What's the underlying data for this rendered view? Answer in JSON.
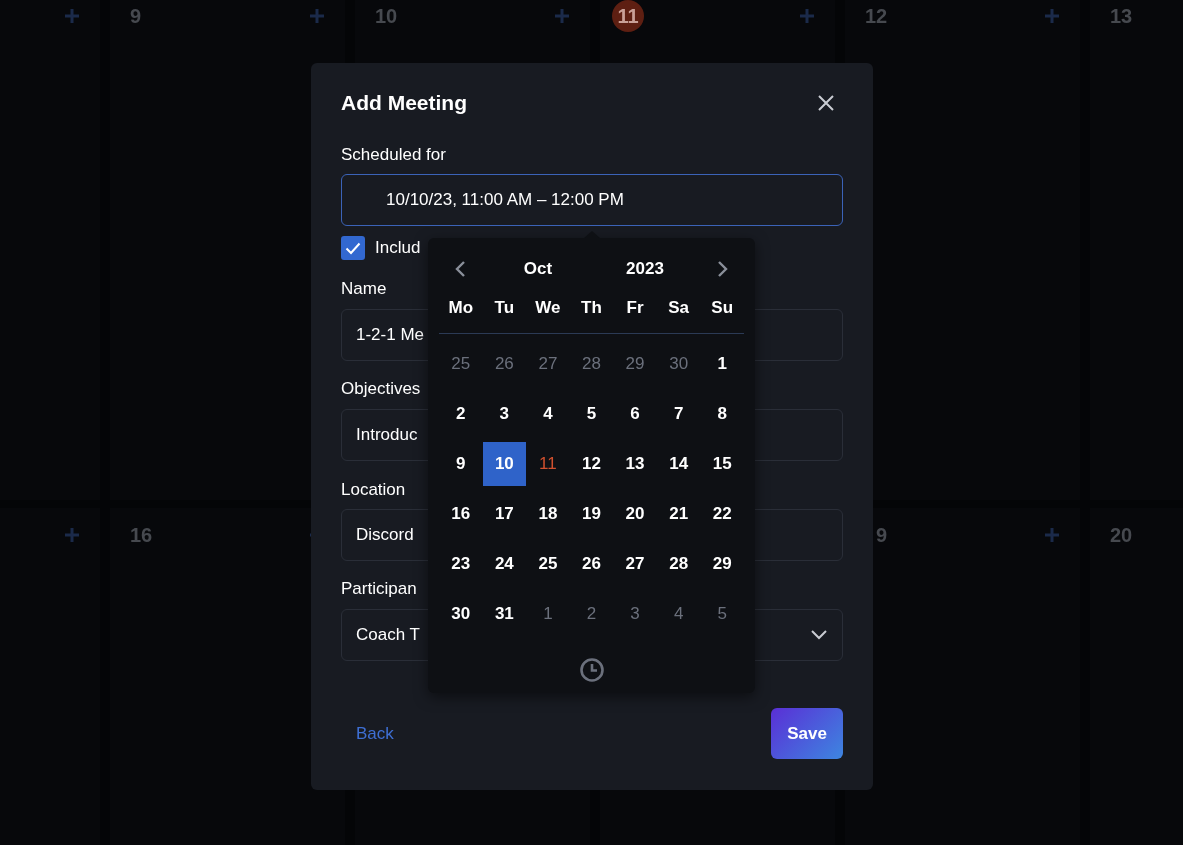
{
  "calendar": {
    "rows": [
      {
        "cells": [
          {
            "plus": true
          },
          {
            "day": "9",
            "today": false,
            "plus": true
          },
          {
            "day": "10",
            "today": false,
            "plus": true
          },
          {
            "day": "11",
            "today": true,
            "plus": true
          },
          {
            "day": "12",
            "today": false,
            "plus": true
          },
          {
            "day": "13",
            "today": false,
            "plus": false
          }
        ]
      },
      {
        "cells": [
          {
            "plus": true
          },
          {
            "day": "16",
            "today": false,
            "plus": true
          },
          {
            "plus": false
          },
          {
            "plus": false
          },
          {
            "day": "9",
            "today": false,
            "plus": true
          },
          {
            "day": "20",
            "today": false,
            "plus": false
          }
        ]
      }
    ]
  },
  "dialog": {
    "title": "Add Meeting",
    "schedule": {
      "label": "Scheduled for",
      "value": "10/10/23, 11:00 AM – 12:00 PM",
      "focused": true
    },
    "checkbox": {
      "label": "Includ",
      "checked": true
    },
    "fields": [
      {
        "label": "Name",
        "value": "1-2-1 Me",
        "kind": "text"
      },
      {
        "label": "Objectives",
        "value": "Introduc",
        "kind": "text"
      },
      {
        "label": "Location",
        "value": "Discord",
        "kind": "text"
      },
      {
        "label": "Participan",
        "value": "Coach T",
        "kind": "select"
      }
    ],
    "back": "Back",
    "save": "Save"
  },
  "picker": {
    "month": "Oct",
    "year": "2023",
    "weekdays": [
      "Mo",
      "Tu",
      "We",
      "Th",
      "Fr",
      "Sa",
      "Su"
    ],
    "days": [
      {
        "label": "25",
        "outside": true,
        "today": false,
        "selected": false
      },
      {
        "label": "26",
        "outside": true,
        "today": false,
        "selected": false
      },
      {
        "label": "27",
        "outside": true,
        "today": false,
        "selected": false
      },
      {
        "label": "28",
        "outside": true,
        "today": false,
        "selected": false
      },
      {
        "label": "29",
        "outside": true,
        "today": false,
        "selected": false
      },
      {
        "label": "30",
        "outside": true,
        "today": false,
        "selected": false
      },
      {
        "label": "1",
        "outside": false,
        "today": false,
        "selected": false
      },
      {
        "label": "2",
        "outside": false,
        "today": false,
        "selected": false
      },
      {
        "label": "3",
        "outside": false,
        "today": false,
        "selected": false
      },
      {
        "label": "4",
        "outside": false,
        "today": false,
        "selected": false
      },
      {
        "label": "5",
        "outside": false,
        "today": false,
        "selected": false
      },
      {
        "label": "6",
        "outside": false,
        "today": false,
        "selected": false
      },
      {
        "label": "7",
        "outside": false,
        "today": false,
        "selected": false
      },
      {
        "label": "8",
        "outside": false,
        "today": false,
        "selected": false
      },
      {
        "label": "9",
        "outside": false,
        "today": false,
        "selected": false
      },
      {
        "label": "10",
        "outside": false,
        "today": false,
        "selected": true
      },
      {
        "label": "11",
        "outside": false,
        "today": true,
        "selected": false
      },
      {
        "label": "12",
        "outside": false,
        "today": false,
        "selected": false
      },
      {
        "label": "13",
        "outside": false,
        "today": false,
        "selected": false
      },
      {
        "label": "14",
        "outside": false,
        "today": false,
        "selected": false
      },
      {
        "label": "15",
        "outside": false,
        "today": false,
        "selected": false
      },
      {
        "label": "16",
        "outside": false,
        "today": false,
        "selected": false
      },
      {
        "label": "17",
        "outside": false,
        "today": false,
        "selected": false
      },
      {
        "label": "18",
        "outside": false,
        "today": false,
        "selected": false
      },
      {
        "label": "19",
        "outside": false,
        "today": false,
        "selected": false
      },
      {
        "label": "20",
        "outside": false,
        "today": false,
        "selected": false
      },
      {
        "label": "21",
        "outside": false,
        "today": false,
        "selected": false
      },
      {
        "label": "22",
        "outside": false,
        "today": false,
        "selected": false
      },
      {
        "label": "23",
        "outside": false,
        "today": false,
        "selected": false
      },
      {
        "label": "24",
        "outside": false,
        "today": false,
        "selected": false
      },
      {
        "label": "25",
        "outside": false,
        "today": false,
        "selected": false
      },
      {
        "label": "26",
        "outside": false,
        "today": false,
        "selected": false
      },
      {
        "label": "27",
        "outside": false,
        "today": false,
        "selected": false
      },
      {
        "label": "28",
        "outside": false,
        "today": false,
        "selected": false
      },
      {
        "label": "29",
        "outside": false,
        "today": false,
        "selected": false
      },
      {
        "label": "30",
        "outside": false,
        "today": false,
        "selected": false
      },
      {
        "label": "31",
        "outside": false,
        "today": false,
        "selected": false
      },
      {
        "label": "1",
        "outside": true,
        "today": false,
        "selected": false
      },
      {
        "label": "2",
        "outside": true,
        "today": false,
        "selected": false
      },
      {
        "label": "3",
        "outside": true,
        "today": false,
        "selected": false
      },
      {
        "label": "4",
        "outside": true,
        "today": false,
        "selected": false
      },
      {
        "label": "5",
        "outside": true,
        "today": false,
        "selected": false
      }
    ]
  }
}
